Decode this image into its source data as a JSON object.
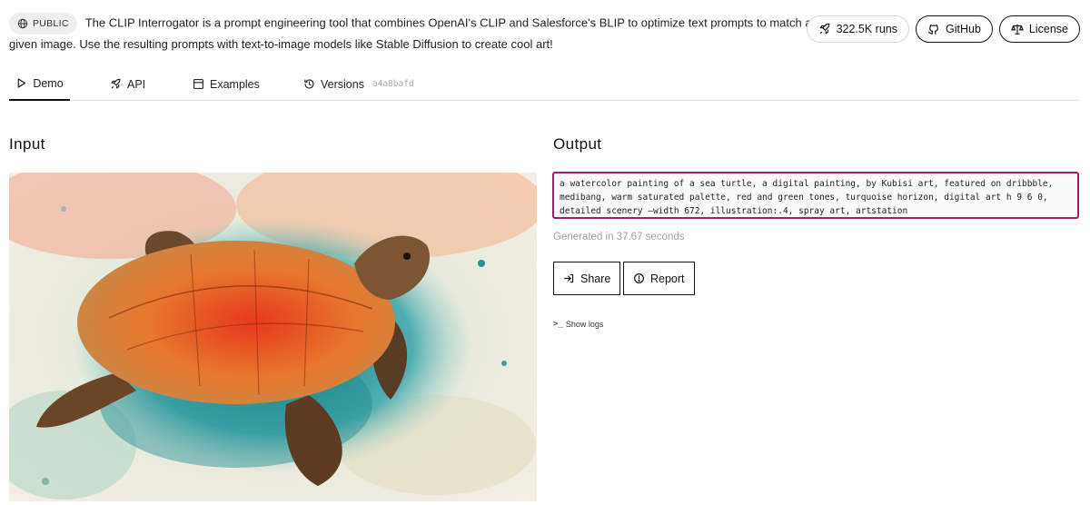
{
  "header": {
    "badge_label": "PUBLIC",
    "description": "The CLIP Interrogator is a prompt engineering tool that combines OpenAI's CLIP and Salesforce's BLIP to optimize text prompts to match a given image. Use the resulting prompts with text-to-image models like Stable Diffusion to create cool art!",
    "runs_label": "322.5K runs",
    "github_label": "GitHub",
    "license_label": "License"
  },
  "tabs": [
    {
      "label": "Demo",
      "icon": "play-icon",
      "active": true
    },
    {
      "label": "API",
      "icon": "rocket-icon"
    },
    {
      "label": "Examples",
      "icon": "gallery-icon"
    },
    {
      "label": "Versions",
      "icon": "history-icon",
      "hash": "a4a8bafd"
    }
  ],
  "input": {
    "title": "Input"
  },
  "output": {
    "title": "Output",
    "text": "a watercolor painting of a sea turtle, a digital painting, by Kubisi art, featured on dribbble, medibang, warm saturated palette, red and green tones, turquoise horizon, digital art h 9 6 0, detailed scenery —width 672, illustration:.4, spray art, artstation",
    "generated": "Generated in 37.67 seconds",
    "share_label": "Share",
    "report_label": "Report",
    "show_logs_label": "Show logs"
  },
  "colors": {
    "output_border": "#9b1f6b",
    "accent_text": "#111111"
  }
}
